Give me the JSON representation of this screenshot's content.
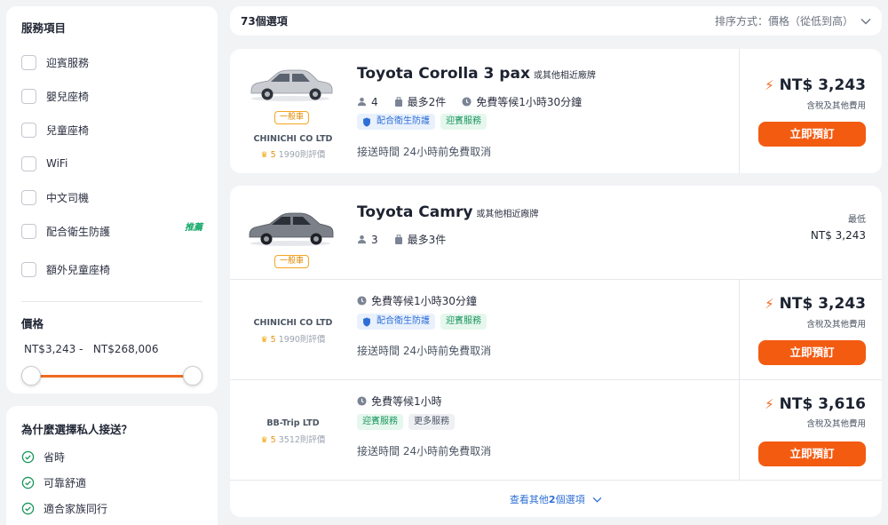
{
  "filters": {
    "services_title": "服務項目",
    "services": [
      "迎賓服務",
      "嬰兒座椅",
      "兒童座椅",
      "WiFi",
      "中文司機",
      "配合衛生防護",
      "額外兒童座椅"
    ],
    "recommended_label": "推薦",
    "price_title": "價格",
    "price_min": "NT$3,243",
    "price_max": "NT$268,006",
    "price_range_text": "NT$3,243 -   NT$268,006"
  },
  "why": {
    "title": "為什麼選擇私人接送？",
    "items": [
      "省時",
      "可靠舒適",
      "適合家族同行"
    ]
  },
  "results": {
    "count": "73個選項",
    "sort_label": "排序方式：價格（從低到高）"
  },
  "card1": {
    "tag": "一般車",
    "company": "CHINICHI CO LTD",
    "rating": "5",
    "reviews": "1990則評價",
    "name": "Toyota Corolla 3 pax",
    "name_sub": "或其他相近廠牌",
    "passengers": "4",
    "luggage": "最多2件",
    "wait": "免費等候1小時30分鐘",
    "badges": [
      "配合衛生防護",
      "迎賓服務"
    ],
    "cancel": "接送時間 24小時前免費取消",
    "price": "NT$ 3,243",
    "taxes": "含稅及其他費用",
    "book": "立即預訂"
  },
  "card2": {
    "tag": "一般車",
    "name": "Toyota Camry",
    "name_sub": "或其他相近廠牌",
    "passengers": "3",
    "luggage": "最多3件",
    "lowest_label": "最低",
    "lowest_price": "NT$ 3,243",
    "offers": [
      {
        "company": "CHINICHI CO LTD",
        "rating": "5",
        "reviews": "1990則評價",
        "wait": "免費等候1小時30分鐘",
        "badges": [
          "配合衛生防護",
          "迎賓服務"
        ],
        "cancel": "接送時間 24小時前免費取消",
        "price": "NT$ 3,243",
        "taxes": "含稅及其他費用",
        "book": "立即預訂"
      },
      {
        "company": "BB-Trip LTD",
        "rating": "5",
        "reviews": "3512則評價",
        "wait": "免費等候1小時",
        "badges": [
          "迎賓服務",
          "更多服務"
        ],
        "cancel": "接送時間 24小時前免費取消",
        "price": "NT$ 3,616",
        "taxes": "含稅及其他費用",
        "book": "立即預訂"
      }
    ],
    "more_prefix": "查看其他",
    "more_count": "2",
    "more_suffix": "個選項"
  },
  "colors": {
    "accent": "#f35b11",
    "link": "#2f6fd6",
    "green": "#17955c",
    "star": "#f0a500"
  },
  "icons": [
    "person-icon",
    "luggage-icon",
    "clock-icon",
    "shield-icon",
    "bolt-icon",
    "check-circle-icon",
    "chevron-down-icon",
    "crown-icon"
  ]
}
